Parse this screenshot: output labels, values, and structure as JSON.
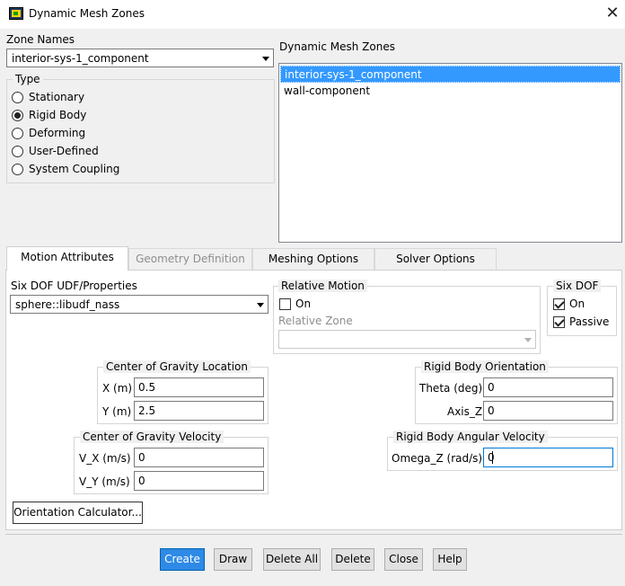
{
  "window": {
    "title": "Dynamic Mesh Zones",
    "close_symbol": "✕"
  },
  "zone_names": {
    "label": "Zone Names",
    "selected": "interior-sys-1_component"
  },
  "type": {
    "label": "Type",
    "options": [
      "Stationary",
      "Rigid Body",
      "Deforming",
      "User-Defined",
      "System Coupling"
    ],
    "selected_index": 1
  },
  "dynamic_mesh_zones": {
    "label": "Dynamic Mesh Zones",
    "items": [
      "interior-sys-1_component",
      "wall-component"
    ],
    "selected_index": 0
  },
  "tabs": [
    {
      "label": "Motion Attributes",
      "state": "active"
    },
    {
      "label": "Geometry Definition",
      "state": "disabled"
    },
    {
      "label": "Meshing Options",
      "state": "normal"
    },
    {
      "label": "Solver Options",
      "state": "normal"
    }
  ],
  "motion": {
    "six_dof_udf": {
      "label": "Six DOF UDF/Properties",
      "selected": "sphere::libudf_nass"
    },
    "relative_motion": {
      "label": "Relative Motion",
      "on_label": "On",
      "on_checked": false,
      "zone_label": "Relative Zone",
      "zone_value": ""
    },
    "six_dof": {
      "label": "Six DOF",
      "on_label": "On",
      "on_checked": true,
      "passive_label": "Passive",
      "passive_checked": true
    },
    "cg_location": {
      "label": "Center of Gravity Location",
      "x_label": "X (m)",
      "x_value": "0.5",
      "y_label": "Y (m)",
      "y_value": "2.5"
    },
    "orientation": {
      "label": "Rigid Body Orientation",
      "theta_label": "Theta (deg)",
      "theta_value": "0",
      "axis_label": "Axis_Z",
      "axis_value": "0"
    },
    "cg_velocity": {
      "label": "Center of Gravity Velocity",
      "vx_label": "V_X (m/s)",
      "vx_value": "0",
      "vy_label": "V_Y (m/s)",
      "vy_value": "0"
    },
    "angular_velocity": {
      "label": "Rigid Body Angular Velocity",
      "omega_label": "Omega_Z (rad/s)",
      "omega_value": "0"
    },
    "orientation_calc_label": "Orientation Calculator..."
  },
  "buttons": {
    "create": "Create",
    "draw": "Draw",
    "delete_all": "Delete All",
    "delete": "Delete",
    "close": "Close",
    "help": "Help"
  },
  "colors": {
    "selection": "#3399ff",
    "primary_button": "#2e8ae6",
    "focus_border": "#0078d7"
  }
}
